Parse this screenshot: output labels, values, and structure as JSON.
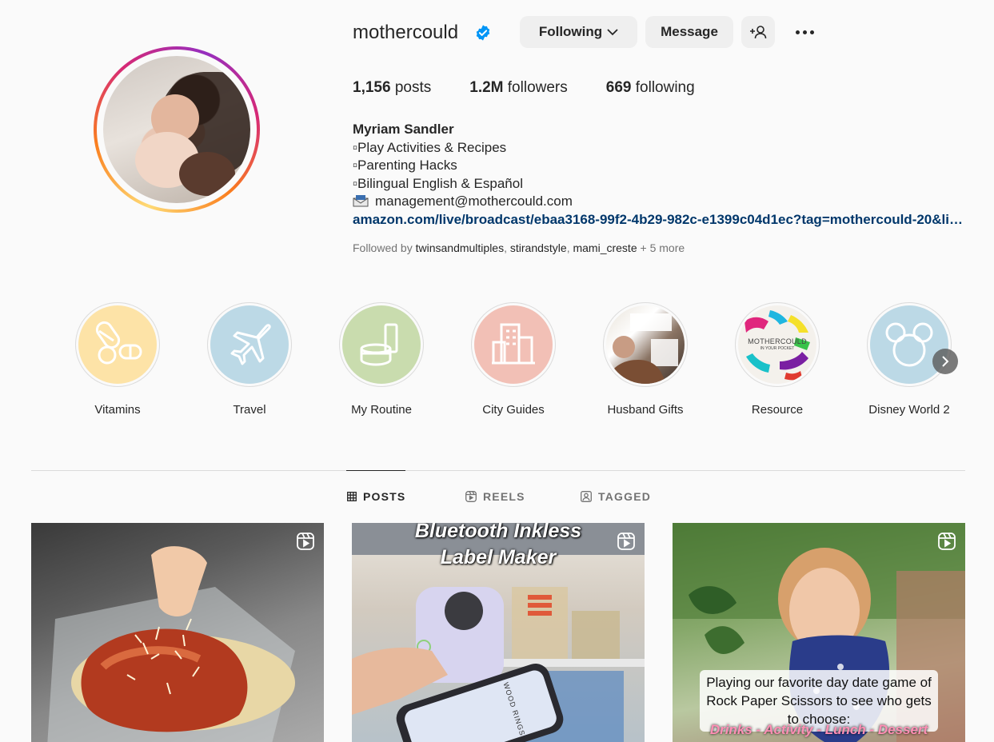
{
  "profile": {
    "username": "mothercould",
    "following_label": "Following",
    "message_label": "Message",
    "stats": {
      "posts_count": "1,156",
      "posts_label": "posts",
      "followers_count": "1.2M",
      "followers_label": "followers",
      "following_count": "669",
      "following_label": "following"
    },
    "bio": {
      "name": "Myriam Sandler",
      "lines": [
        "▫Play Activities & Recipes",
        "▫Parenting Hacks",
        "▫Bilingual English & Español"
      ],
      "email": "management@mothercould.com",
      "link": "amazon.com/live/broadcast/ebaa3168-99f2-4b29-982c-e1399c04d1ec?tag=mothercould-20&linkCode=ilv"
    },
    "followed_by": {
      "prefix": "Followed by",
      "users": [
        "twinsandmultiples",
        "stirandstyle",
        "mami_creste"
      ],
      "more": "+ 5 more"
    }
  },
  "highlights": [
    {
      "label": "Vitamins",
      "color": "#fde3a7"
    },
    {
      "label": "Travel",
      "color": "#bcd9e6"
    },
    {
      "label": "My Routine",
      "color": "#c9dcae"
    },
    {
      "label": "City Guides",
      "color": "#f2c0b6"
    },
    {
      "label": "Husband Gifts",
      "color": "#8a7464"
    },
    {
      "label": "Resource",
      "color": "#f4f1ec",
      "brand": "MOTHERCOULD",
      "tagline": "IN YOUR POCKET"
    },
    {
      "label": "Disney World 2",
      "color": "#bcd9e6"
    }
  ],
  "tabs": [
    {
      "label": "POSTS",
      "active": true
    },
    {
      "label": "REELS",
      "active": false
    },
    {
      "label": "TAGGED",
      "active": false
    }
  ],
  "posts": [
    {
      "icon": "reel-icon"
    },
    {
      "icon": "reel-icon",
      "title_line1": "Bluetooth Inkless",
      "title_line2": "Label Maker",
      "phone_text": "WOOD RINGS"
    },
    {
      "icon": "reel-icon",
      "caption": "Playing our favorite day date game of Rock Paper Scissors to see who gets to choose:",
      "caption2": "Drinks - Activity - Lunch - Dessert"
    }
  ],
  "colors": {
    "accent_link": "#00376b",
    "verified": "#0095f6",
    "button_bg": "#efefef"
  }
}
